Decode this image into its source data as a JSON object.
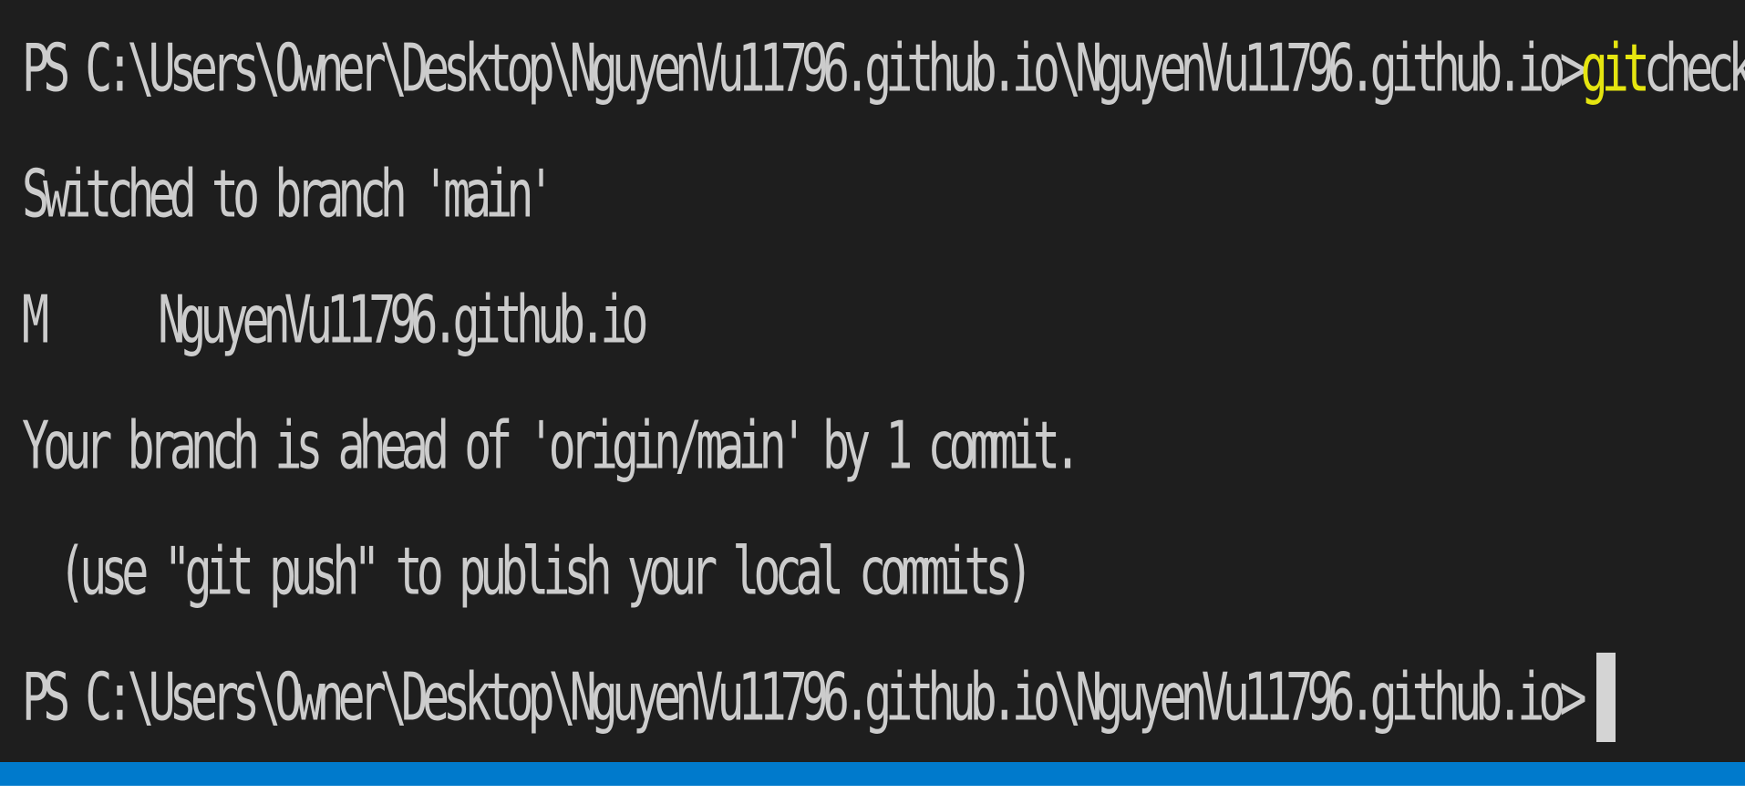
{
  "theme": {
    "terminal_bg": "#1e1e1e",
    "text_color": "#cccccc",
    "command_highlight": "#e5e510",
    "cursor_color": "#d4d4d4",
    "status_bar_color": "#007acc",
    "page_bg": "#ffffff"
  },
  "terminal": {
    "prompt": "PS C:\\Users\\Owner\\Desktop\\NguyenVu11796.github.io\\NguyenVu11796.github.io>",
    "command": {
      "program": "git",
      "args": "checkout main"
    },
    "output": {
      "switched": "Switched to branch 'main'",
      "modified_status": "M",
      "modified_path": "NguyenVu11796.github.io",
      "branch_ahead": "Your branch is ahead of 'origin/main' by 1 commit.",
      "push_hint": "(use \"git push\" to publish your local commits)"
    },
    "cursor": "block-cursor"
  }
}
